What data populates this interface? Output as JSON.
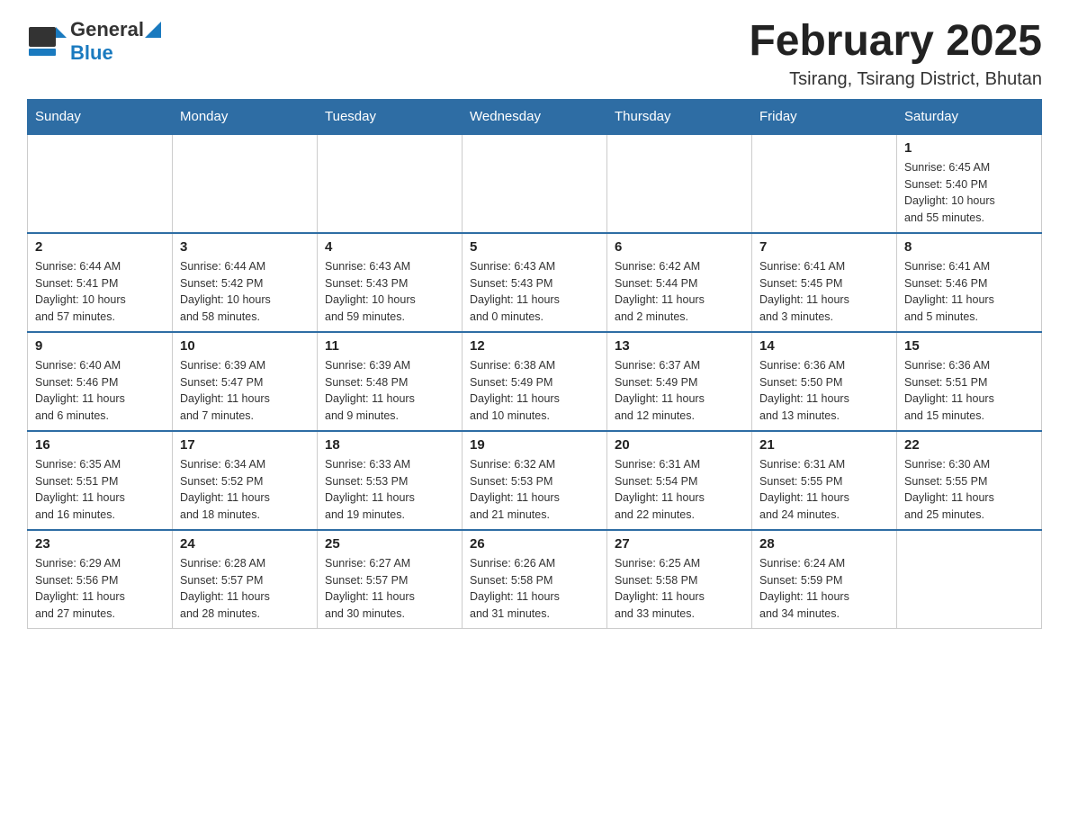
{
  "header": {
    "logo_general": "General",
    "logo_blue": "Blue",
    "main_title": "February 2025",
    "subtitle": "Tsirang, Tsirang District, Bhutan"
  },
  "days_of_week": [
    "Sunday",
    "Monday",
    "Tuesday",
    "Wednesday",
    "Thursday",
    "Friday",
    "Saturday"
  ],
  "weeks": [
    [
      {
        "day": "",
        "info": ""
      },
      {
        "day": "",
        "info": ""
      },
      {
        "day": "",
        "info": ""
      },
      {
        "day": "",
        "info": ""
      },
      {
        "day": "",
        "info": ""
      },
      {
        "day": "",
        "info": ""
      },
      {
        "day": "1",
        "info": "Sunrise: 6:45 AM\nSunset: 5:40 PM\nDaylight: 10 hours\nand 55 minutes."
      }
    ],
    [
      {
        "day": "2",
        "info": "Sunrise: 6:44 AM\nSunset: 5:41 PM\nDaylight: 10 hours\nand 57 minutes."
      },
      {
        "day": "3",
        "info": "Sunrise: 6:44 AM\nSunset: 5:42 PM\nDaylight: 10 hours\nand 58 minutes."
      },
      {
        "day": "4",
        "info": "Sunrise: 6:43 AM\nSunset: 5:43 PM\nDaylight: 10 hours\nand 59 minutes."
      },
      {
        "day": "5",
        "info": "Sunrise: 6:43 AM\nSunset: 5:43 PM\nDaylight: 11 hours\nand 0 minutes."
      },
      {
        "day": "6",
        "info": "Sunrise: 6:42 AM\nSunset: 5:44 PM\nDaylight: 11 hours\nand 2 minutes."
      },
      {
        "day": "7",
        "info": "Sunrise: 6:41 AM\nSunset: 5:45 PM\nDaylight: 11 hours\nand 3 minutes."
      },
      {
        "day": "8",
        "info": "Sunrise: 6:41 AM\nSunset: 5:46 PM\nDaylight: 11 hours\nand 5 minutes."
      }
    ],
    [
      {
        "day": "9",
        "info": "Sunrise: 6:40 AM\nSunset: 5:46 PM\nDaylight: 11 hours\nand 6 minutes."
      },
      {
        "day": "10",
        "info": "Sunrise: 6:39 AM\nSunset: 5:47 PM\nDaylight: 11 hours\nand 7 minutes."
      },
      {
        "day": "11",
        "info": "Sunrise: 6:39 AM\nSunset: 5:48 PM\nDaylight: 11 hours\nand 9 minutes."
      },
      {
        "day": "12",
        "info": "Sunrise: 6:38 AM\nSunset: 5:49 PM\nDaylight: 11 hours\nand 10 minutes."
      },
      {
        "day": "13",
        "info": "Sunrise: 6:37 AM\nSunset: 5:49 PM\nDaylight: 11 hours\nand 12 minutes."
      },
      {
        "day": "14",
        "info": "Sunrise: 6:36 AM\nSunset: 5:50 PM\nDaylight: 11 hours\nand 13 minutes."
      },
      {
        "day": "15",
        "info": "Sunrise: 6:36 AM\nSunset: 5:51 PM\nDaylight: 11 hours\nand 15 minutes."
      }
    ],
    [
      {
        "day": "16",
        "info": "Sunrise: 6:35 AM\nSunset: 5:51 PM\nDaylight: 11 hours\nand 16 minutes."
      },
      {
        "day": "17",
        "info": "Sunrise: 6:34 AM\nSunset: 5:52 PM\nDaylight: 11 hours\nand 18 minutes."
      },
      {
        "day": "18",
        "info": "Sunrise: 6:33 AM\nSunset: 5:53 PM\nDaylight: 11 hours\nand 19 minutes."
      },
      {
        "day": "19",
        "info": "Sunrise: 6:32 AM\nSunset: 5:53 PM\nDaylight: 11 hours\nand 21 minutes."
      },
      {
        "day": "20",
        "info": "Sunrise: 6:31 AM\nSunset: 5:54 PM\nDaylight: 11 hours\nand 22 minutes."
      },
      {
        "day": "21",
        "info": "Sunrise: 6:31 AM\nSunset: 5:55 PM\nDaylight: 11 hours\nand 24 minutes."
      },
      {
        "day": "22",
        "info": "Sunrise: 6:30 AM\nSunset: 5:55 PM\nDaylight: 11 hours\nand 25 minutes."
      }
    ],
    [
      {
        "day": "23",
        "info": "Sunrise: 6:29 AM\nSunset: 5:56 PM\nDaylight: 11 hours\nand 27 minutes."
      },
      {
        "day": "24",
        "info": "Sunrise: 6:28 AM\nSunset: 5:57 PM\nDaylight: 11 hours\nand 28 minutes."
      },
      {
        "day": "25",
        "info": "Sunrise: 6:27 AM\nSunset: 5:57 PM\nDaylight: 11 hours\nand 30 minutes."
      },
      {
        "day": "26",
        "info": "Sunrise: 6:26 AM\nSunset: 5:58 PM\nDaylight: 11 hours\nand 31 minutes."
      },
      {
        "day": "27",
        "info": "Sunrise: 6:25 AM\nSunset: 5:58 PM\nDaylight: 11 hours\nand 33 minutes."
      },
      {
        "day": "28",
        "info": "Sunrise: 6:24 AM\nSunset: 5:59 PM\nDaylight: 11 hours\nand 34 minutes."
      },
      {
        "day": "",
        "info": ""
      }
    ]
  ]
}
